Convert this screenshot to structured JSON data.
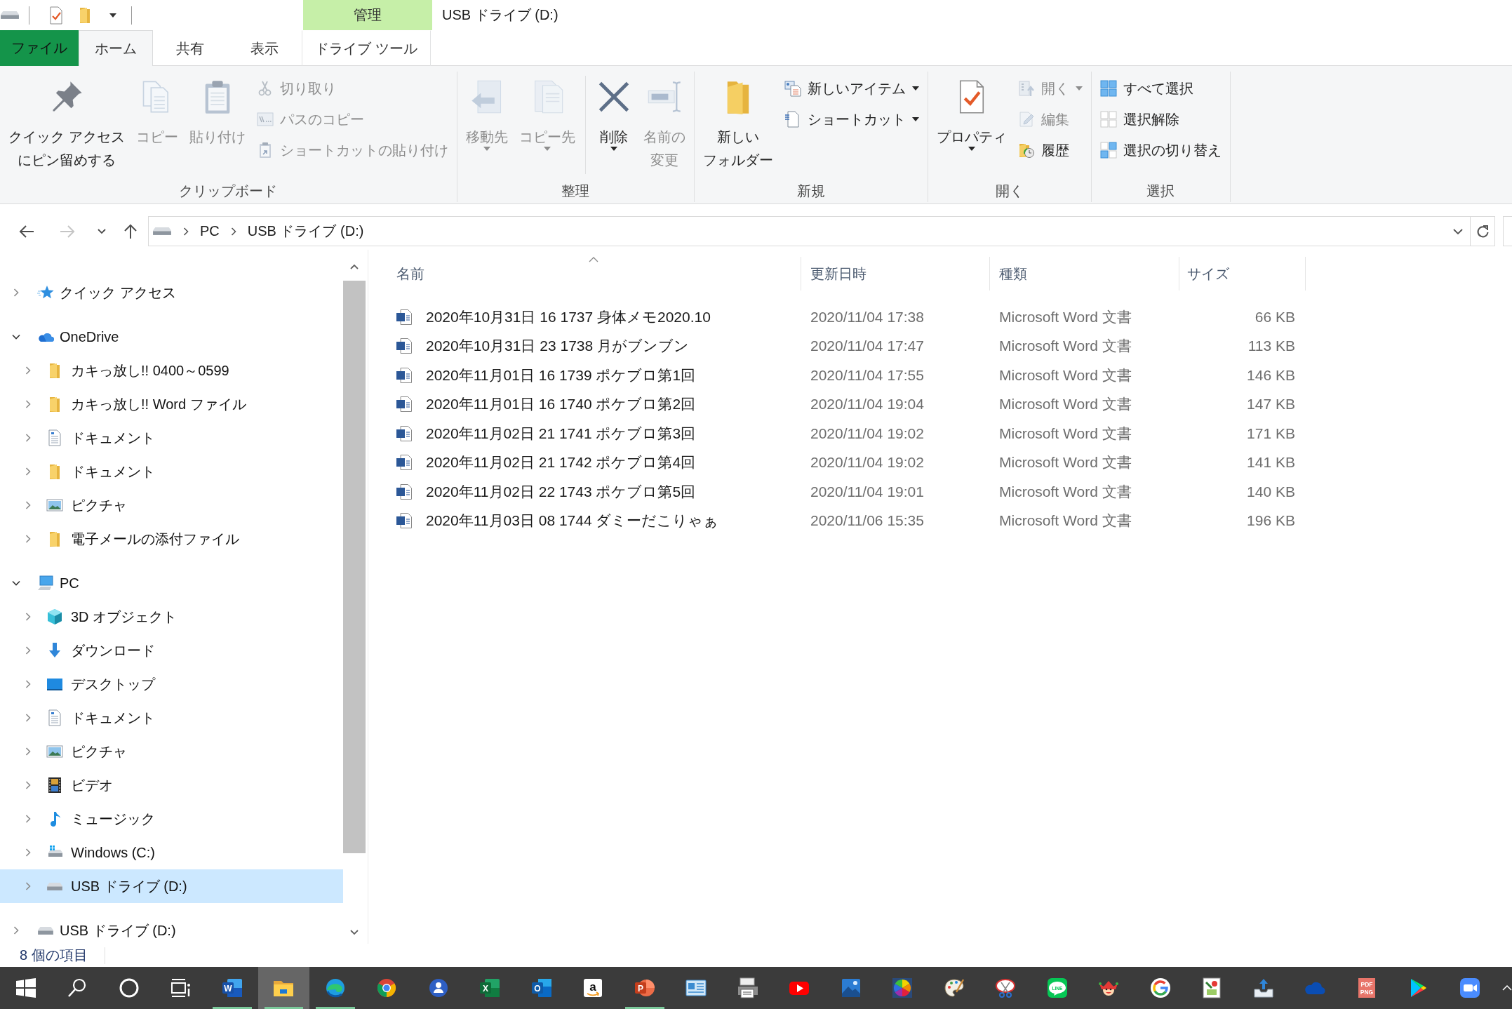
{
  "title_bar": {
    "context_label": "管理",
    "title": "USB ドライブ (D:)"
  },
  "tabs": [
    {
      "label": "ファイル",
      "kind": "file",
      "selected": false
    },
    {
      "label": "ホーム",
      "kind": "normal",
      "selected": true
    },
    {
      "label": "共有",
      "kind": "normal",
      "selected": false
    },
    {
      "label": "表示",
      "kind": "normal",
      "selected": false
    },
    {
      "label": "ドライブ ツール",
      "kind": "contextual",
      "selected": false
    }
  ],
  "ribbon": {
    "groups": [
      {
        "label": "クリップボード",
        "buttons": [
          {
            "kind": "large",
            "lines": [
              "クイック アクセス",
              "にピン留めする"
            ],
            "disabled": false,
            "dropdown": false
          },
          {
            "kind": "large",
            "lines": [
              "コピー"
            ],
            "disabled": true,
            "dropdown": false
          },
          {
            "kind": "large",
            "lines": [
              "貼り付け"
            ],
            "disabled": true,
            "dropdown": false
          }
        ],
        "stack": [
          {
            "label": "切り取り",
            "disabled": true,
            "dropdown": false
          },
          {
            "label": "パスのコピー",
            "disabled": true,
            "dropdown": false
          },
          {
            "label": "ショートカットの貼り付け",
            "disabled": true,
            "dropdown": false
          }
        ]
      },
      {
        "label": "整理",
        "buttons": [
          {
            "kind": "large",
            "lines": [
              "移動先"
            ],
            "disabled": true,
            "dropdown": true
          },
          {
            "kind": "large",
            "lines": [
              "コピー先"
            ],
            "disabled": true,
            "dropdown": true
          },
          {
            "kind": "separator"
          },
          {
            "kind": "large",
            "lines": [
              "削除"
            ],
            "disabled": false,
            "dropdown": true
          },
          {
            "kind": "large",
            "lines": [
              "名前の",
              "変更"
            ],
            "disabled": true,
            "dropdown": false
          }
        ]
      },
      {
        "label": "新規",
        "buttons": [
          {
            "kind": "large",
            "lines": [
              "新しい",
              "フォルダー"
            ],
            "disabled": false,
            "dropdown": false
          }
        ],
        "stack": [
          {
            "label": "新しいアイテム",
            "disabled": false,
            "dropdown": true
          },
          {
            "label": "ショートカット",
            "disabled": false,
            "dropdown": true
          }
        ]
      },
      {
        "label": "開く",
        "buttons": [
          {
            "kind": "large",
            "lines": [
              "プロパティ"
            ],
            "disabled": false,
            "dropdown": true
          }
        ],
        "stack": [
          {
            "label": "開く",
            "disabled": true,
            "dropdown": true
          },
          {
            "label": "編集",
            "disabled": true,
            "dropdown": false
          },
          {
            "label": "履歴",
            "disabled": false,
            "dropdown": false
          }
        ]
      },
      {
        "label": "選択",
        "stack": [
          {
            "label": "すべて選択",
            "disabled": false,
            "dropdown": false
          },
          {
            "label": "選択解除",
            "disabled": false,
            "dropdown": false
          },
          {
            "label": "選択の切り替え",
            "disabled": false,
            "dropdown": false
          }
        ]
      }
    ]
  },
  "address": {
    "nav_buttons": [
      {
        "kind": "back",
        "disabled": false
      },
      {
        "kind": "forward",
        "disabled": true
      },
      {
        "kind": "recent",
        "disabled": false
      },
      {
        "kind": "up",
        "disabled": false
      }
    ],
    "path": [
      "PC",
      "USB ドライブ (D:)"
    ]
  },
  "navigation_pane": {
    "items": [
      {
        "label": "クイック アクセス",
        "kind": "quick-access",
        "expanded": false,
        "selected": false
      },
      {
        "label": "OneDrive",
        "kind": "cloud",
        "expanded": true,
        "selected": false,
        "children": [
          {
            "label": "カキっ放し!! 0400～0599",
            "kind": "folder",
            "expanded": false,
            "selected": false
          },
          {
            "label": "カキっ放し!! Word ファイル",
            "kind": "folder",
            "expanded": false,
            "selected": false
          },
          {
            "label": "ドキュメント",
            "kind": "documents",
            "expanded": false,
            "selected": false
          },
          {
            "label": "ドキュメント",
            "kind": "folder",
            "expanded": false,
            "selected": false
          },
          {
            "label": "ピクチャ",
            "kind": "pictures",
            "expanded": false,
            "selected": false
          },
          {
            "label": "電子メールの添付ファイル",
            "kind": "folder",
            "expanded": false,
            "selected": false
          }
        ]
      },
      {
        "label": "PC",
        "kind": "pc",
        "expanded": true,
        "selected": false,
        "children": [
          {
            "label": "3D オブジェクト",
            "kind": "objects-3d",
            "expanded": false,
            "selected": false
          },
          {
            "label": "ダウンロード",
            "kind": "downloads",
            "expanded": false,
            "selected": false
          },
          {
            "label": "デスクトップ",
            "kind": "desktop",
            "expanded": false,
            "selected": false
          },
          {
            "label": "ドキュメント",
            "kind": "documents",
            "expanded": false,
            "selected": false
          },
          {
            "label": "ピクチャ",
            "kind": "pictures",
            "expanded": false,
            "selected": false
          },
          {
            "label": "ビデオ",
            "kind": "videos",
            "expanded": false,
            "selected": false
          },
          {
            "label": "ミュージック",
            "kind": "music",
            "expanded": false,
            "selected": false
          },
          {
            "label": "Windows (C:)",
            "kind": "system-drive",
            "expanded": false,
            "selected": false
          },
          {
            "label": "USB ドライブ (D:)",
            "kind": "drive",
            "expanded": false,
            "selected": true
          }
        ]
      },
      {
        "label": "USB ドライブ (D:)",
        "kind": "drive",
        "expanded": false,
        "selected": false
      }
    ]
  },
  "file_list": {
    "columns": [
      {
        "label": "名前",
        "sorted": true
      },
      {
        "label": "更新日時",
        "sorted": false
      },
      {
        "label": "種類",
        "sorted": false
      },
      {
        "label": "サイズ",
        "sorted": false
      }
    ],
    "rows": [
      {
        "name": "2020年10月31日 16 1737 身体メモ2020.10",
        "modified": "2020/11/04 17:38",
        "type": "Microsoft Word 文書",
        "size": "66 KB",
        "selected": false
      },
      {
        "name": "2020年10月31日 23 1738 月がブンブン",
        "modified": "2020/11/04 17:47",
        "type": "Microsoft Word 文書",
        "size": "113 KB",
        "selected": false
      },
      {
        "name": "2020年11月01日 16 1739 ポケブロ第1回",
        "modified": "2020/11/04 17:55",
        "type": "Microsoft Word 文書",
        "size": "146 KB",
        "selected": false
      },
      {
        "name": "2020年11月01日 16 1740 ポケブロ第2回",
        "modified": "2020/11/04 19:04",
        "type": "Microsoft Word 文書",
        "size": "147 KB",
        "selected": false
      },
      {
        "name": "2020年11月02日 21 1741 ポケブロ第3回",
        "modified": "2020/11/04 19:02",
        "type": "Microsoft Word 文書",
        "size": "171 KB",
        "selected": false
      },
      {
        "name": "2020年11月02日 21 1742 ポケブロ第4回",
        "modified": "2020/11/04 19:02",
        "type": "Microsoft Word 文書",
        "size": "141 KB",
        "selected": false
      },
      {
        "name": "2020年11月02日 22 1743 ポケブロ第5回",
        "modified": "2020/11/04 19:01",
        "type": "Microsoft Word 文書",
        "size": "140 KB",
        "selected": false
      },
      {
        "name": "2020年11月03日 08 1744 ダミーだこりゃぁ",
        "modified": "2020/11/06 15:35",
        "type": "Microsoft Word 文書",
        "size": "196 KB",
        "selected": false
      }
    ]
  },
  "status_bar": {
    "item_count": "8 個の項目"
  },
  "taskbar": {
    "items": [
      {
        "kind": "start",
        "running": false,
        "selected": false
      },
      {
        "kind": "search",
        "running": false,
        "selected": false
      },
      {
        "kind": "cortana",
        "running": false,
        "selected": false
      },
      {
        "kind": "task-view",
        "running": false,
        "selected": false
      },
      {
        "kind": "word",
        "glyph": [
          "W"
        ],
        "running": true,
        "selected": false
      },
      {
        "kind": "explorer",
        "running": true,
        "selected": true
      },
      {
        "kind": "edge",
        "running": true,
        "selected": false
      },
      {
        "kind": "chrome",
        "running": false,
        "selected": false
      },
      {
        "kind": "people",
        "running": false,
        "selected": false
      },
      {
        "kind": "excel",
        "glyph": [
          "X"
        ],
        "running": false,
        "selected": false
      },
      {
        "kind": "outlook",
        "glyph": [
          "O"
        ],
        "running": false,
        "selected": false
      },
      {
        "kind": "amazon",
        "glyph": [
          "a"
        ],
        "running": false,
        "selected": false
      },
      {
        "kind": "powerpoint",
        "glyph": [
          "P"
        ],
        "running": true,
        "selected": false
      },
      {
        "kind": "id-card",
        "running": false,
        "selected": false
      },
      {
        "kind": "scanner",
        "running": false,
        "selected": false
      },
      {
        "kind": "youtube",
        "running": false,
        "selected": false
      },
      {
        "kind": "photos",
        "running": false,
        "selected": false
      },
      {
        "kind": "color-square",
        "running": false,
        "selected": false
      },
      {
        "kind": "paint",
        "running": false,
        "selected": false
      },
      {
        "kind": "snipping",
        "running": false,
        "selected": false
      },
      {
        "kind": "line",
        "glyph": [
          "LINE"
        ],
        "running": false,
        "selected": false
      },
      {
        "kind": "jester",
        "running": false,
        "selected": false
      },
      {
        "kind": "google",
        "running": false,
        "selected": false
      },
      {
        "kind": "pc-tool",
        "running": false,
        "selected": false
      },
      {
        "kind": "upload",
        "running": false,
        "selected": false
      },
      {
        "kind": "onedrive",
        "running": false,
        "selected": false
      },
      {
        "kind": "pdf",
        "glyph": [
          "PDF",
          "PNG"
        ],
        "running": false,
        "selected": false
      },
      {
        "kind": "play-store",
        "running": false,
        "selected": false
      },
      {
        "kind": "zoom",
        "running": false,
        "selected": false
      }
    ]
  }
}
